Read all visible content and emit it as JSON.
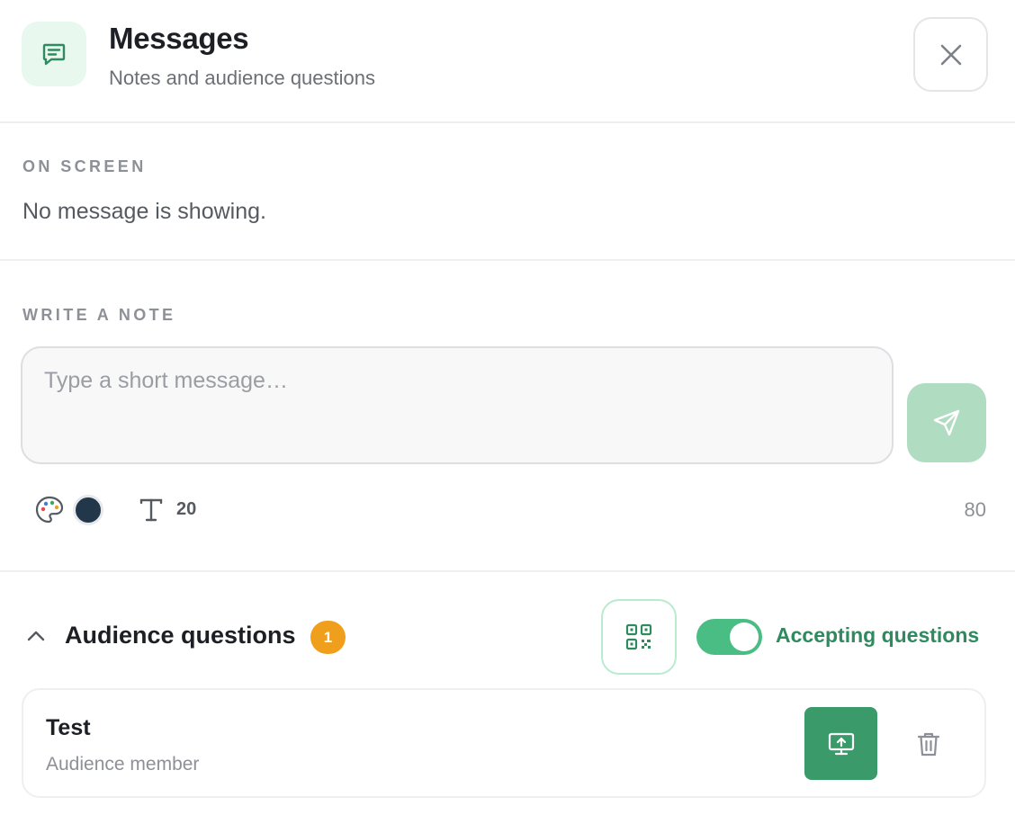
{
  "header": {
    "title": "Messages",
    "subtitle": "Notes and audience questions",
    "icon": "message-square-icon",
    "close_icon": "close-icon"
  },
  "on_screen": {
    "label": "ON SCREEN",
    "status": "No message is showing."
  },
  "note": {
    "label": "WRITE A NOTE",
    "placeholder": "Type a short message…",
    "value": "",
    "send_icon": "send-icon",
    "palette_icon": "palette-icon",
    "text_color": "#22384a",
    "font_icon": "font-size-icon",
    "font_size": "20",
    "char_remaining": "80"
  },
  "audience_questions": {
    "title": "Audience questions",
    "count": "1",
    "expanded": true,
    "qr_icon": "qr-code-icon",
    "accepting": true,
    "toggle_label": "Accepting questions",
    "questions": [
      {
        "text": "Test",
        "author": "Audience member",
        "present_icon": "present-screen-icon",
        "delete_icon": "trash-icon"
      }
    ]
  },
  "colors": {
    "accent_green": "#3a9a6a",
    "toggle_green": "#49bd83",
    "badge_orange": "#ef9f1c",
    "send_disabled": "#b0dcc2"
  }
}
